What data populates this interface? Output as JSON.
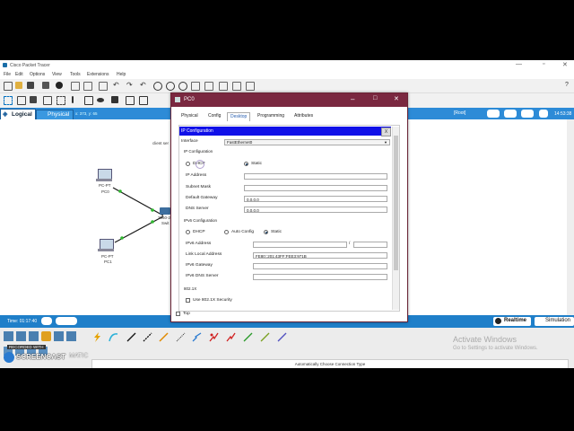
{
  "app": {
    "title": "Cisco Packet Tracer",
    "menu": [
      "File",
      "Edit",
      "Options",
      "View",
      "Tools",
      "Extensions",
      "Help"
    ],
    "help_icon": "?"
  },
  "topology": {
    "logical_tab": "Logical",
    "physical_tab": "Physical",
    "coords": "x: 373, y: 65",
    "root_label": "[Root]",
    "clock": "14:53:38"
  },
  "canvas": {
    "note": "client ser",
    "devices": {
      "pc0_type": "PC-PT",
      "pc0_name": "PC0",
      "pc1_type": "PC-PT",
      "pc1_name": "PC1",
      "switch_type": "2960-2",
      "switch_name": "Swit"
    }
  },
  "status": {
    "time": "Time: 01:17:40",
    "realtime": "Realtime",
    "simulation": "Simulation"
  },
  "connections": {
    "hint": "Automatically Choose Connection Type"
  },
  "watermarks": {
    "activate_title": "Activate Windows",
    "activate_sub": "Go to Settings to activate Windows.",
    "recorded": "RECORDED WITH",
    "screencast": "SCREENCAST",
    "matic": "MATIC"
  },
  "dialog": {
    "title": "PC0",
    "tabs": [
      "Physical",
      "Config",
      "Desktop",
      "Programming",
      "Attributes"
    ],
    "active_tab": "Desktop",
    "top_label": "Top",
    "ipconfig": {
      "header": "IP Configuration",
      "close": "X",
      "interface_label": "Interface",
      "interface_value": "FastEthernet0",
      "section_ip": "IP Configuration",
      "dhcp_label": "DHCP",
      "static_label": "Static",
      "ip_label": "IP Address",
      "ip_value": "",
      "subnet_label": "Subnet Mask",
      "subnet_value": "",
      "gateway_label": "Default Gateway",
      "gateway_value": "0.0.0.0",
      "dns_label": "DNS Server",
      "dns_value": "0.0.0.0",
      "section_ipv6": "IPv6 Configuration",
      "v6_dhcp": "DHCP",
      "v6_auto": "Auto Config",
      "v6_static": "Static",
      "v6_ip_label": "IPv6 Address",
      "v6_sep": "/",
      "v6_link_label": "Link Local Address",
      "v6_link_value": "FE80::201:43FF:FEE3:971B",
      "v6_gw_label": "IPv6 Gateway",
      "v6_dns_label": "IPv6 DNS Server",
      "section_8021x": "802.1X",
      "use_8021x": "Use 802.1X Security"
    }
  }
}
